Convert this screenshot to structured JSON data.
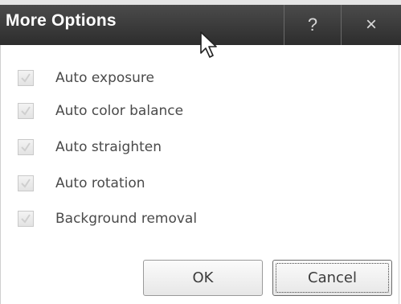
{
  "dialog": {
    "title": "More Options",
    "help_glyph": "?",
    "close_glyph": "×"
  },
  "options": [
    {
      "label": "Auto exposure",
      "checked": true,
      "enabled": false
    },
    {
      "label": "Auto color balance",
      "checked": true,
      "enabled": false
    },
    {
      "label": "Auto straighten",
      "checked": true,
      "enabled": false
    },
    {
      "label": "Auto rotation",
      "checked": true,
      "enabled": false
    },
    {
      "label": "Background removal",
      "checked": true,
      "enabled": false
    }
  ],
  "buttons": {
    "ok": "OK",
    "cancel": "Cancel"
  },
  "icons": [
    "help-icon",
    "close-icon",
    "mouse-cursor-icon",
    "checkmark-icon"
  ],
  "colors": {
    "titlebar": "#3a3a3a",
    "title_text": "#ffffff",
    "label_text": "#4a4a4a",
    "checkbox_disabled": "#e8e8e8"
  }
}
